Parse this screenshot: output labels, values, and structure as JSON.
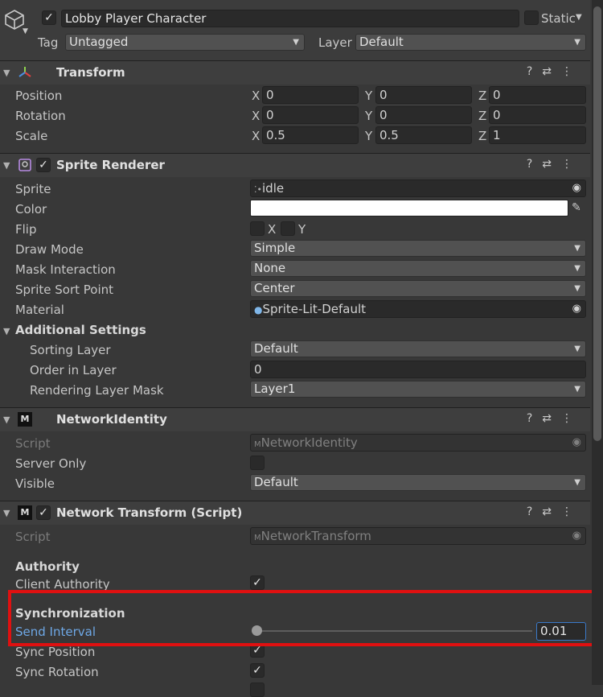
{
  "header": {
    "object_name": "Lobby Player Character",
    "static_label": "Static",
    "tag_label": "Tag",
    "tag_value": "Untagged",
    "layer_label": "Layer",
    "layer_value": "Default"
  },
  "transform": {
    "title": "Transform",
    "rows": [
      {
        "label": "Position",
        "x": "0",
        "y": "0",
        "z": "0"
      },
      {
        "label": "Rotation",
        "x": "0",
        "y": "0",
        "z": "0"
      },
      {
        "label": "Scale",
        "x": "0.5",
        "y": "0.5",
        "z": "1"
      }
    ],
    "axis_x": "X",
    "axis_y": "Y",
    "axis_z": "Z"
  },
  "sprite_renderer": {
    "title": "Sprite Renderer",
    "sprite_label": "Sprite",
    "sprite_value": "idle",
    "color_label": "Color",
    "color_value": "#ffffff",
    "flip_label": "Flip",
    "flip_x": "X",
    "flip_y": "Y",
    "draw_mode_label": "Draw Mode",
    "draw_mode_value": "Simple",
    "mask_label": "Mask Interaction",
    "mask_value": "None",
    "sort_point_label": "Sprite Sort Point",
    "sort_point_value": "Center",
    "material_label": "Material",
    "material_value": "Sprite-Lit-Default",
    "additional_label": "Additional Settings",
    "sorting_layer_label": "Sorting Layer",
    "sorting_layer_value": "Default",
    "order_label": "Order in Layer",
    "order_value": "0",
    "rendering_mask_label": "Rendering Layer Mask",
    "rendering_mask_value": "Layer1"
  },
  "network_identity": {
    "title": "NetworkIdentity",
    "script_label": "Script",
    "script_value": "NetworkIdentity",
    "server_only_label": "Server Only",
    "visible_label": "Visible",
    "visible_value": "Default"
  },
  "network_transform": {
    "title": "Network Transform (Script)",
    "script_label": "Script",
    "script_value": "NetworkTransform",
    "authority_heading": "Authority",
    "client_authority_label": "Client Authority",
    "sync_heading": "Synchronization",
    "send_interval_label": "Send Interval",
    "send_interval_value": "0.01",
    "sync_position_label": "Sync Position",
    "sync_rotation_label": "Sync Rotation"
  },
  "colors": {
    "highlight": "#e01010",
    "link_blue": "#6ea8e6",
    "focus_blue": "#3a79c9"
  }
}
